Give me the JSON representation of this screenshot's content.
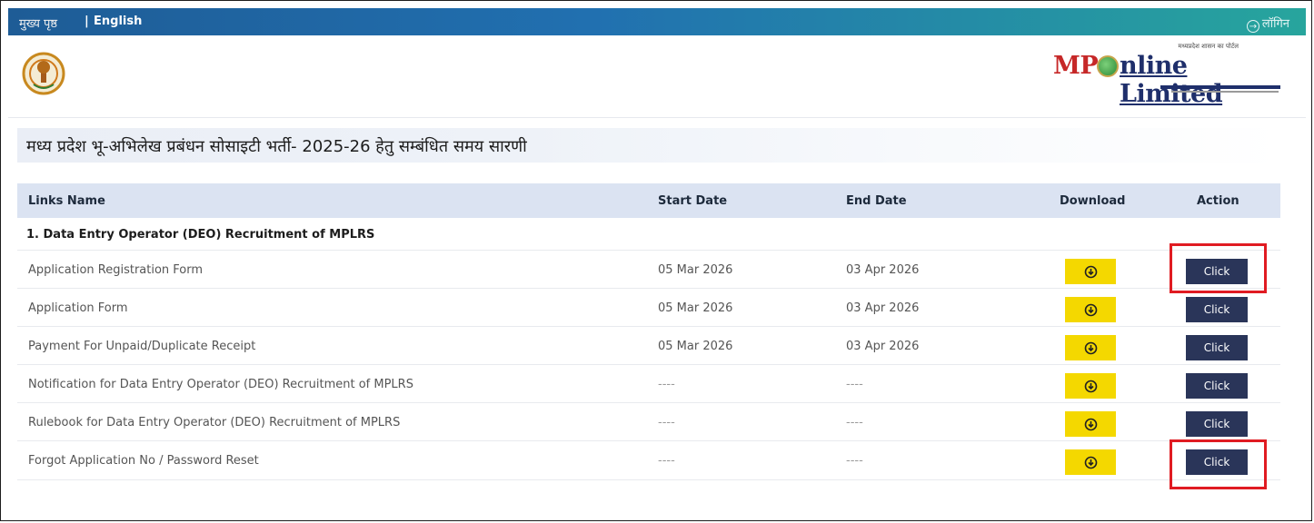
{
  "topbar": {
    "home_label": "मुख्य पृष्ठ",
    "separator": "|",
    "language_label": "English",
    "login_label": "लॉगिन"
  },
  "brand": {
    "tagline": "मध्यप्रदेश शासन का पोर्टल",
    "name_prefix": "MP",
    "name_rest": "nline Limited"
  },
  "page": {
    "title": "मध्य प्रदेश भू-अभिलेख प्रबंधन सोसाइटी भर्ती- 2025-26 हेतु सम्बंधित समय सारणी"
  },
  "table": {
    "headers": {
      "links_name": "Links Name",
      "start_date": "Start Date",
      "end_date": "End Date",
      "download": "Download",
      "action": "Action"
    },
    "section_title": "1. Data Entry Operator (DEO) Recruitment of MPLRS",
    "rows": [
      {
        "name": "Application Registration Form",
        "start": "05 Mar 2026",
        "end": "03 Apr 2026",
        "action": "Click"
      },
      {
        "name": "Application Form",
        "start": "05 Mar 2026",
        "end": "03 Apr 2026",
        "action": "Click"
      },
      {
        "name": "Payment For Unpaid/Duplicate Receipt",
        "start": "05 Mar 2026",
        "end": "03 Apr 2026",
        "action": "Click"
      },
      {
        "name": "Notification for Data Entry Operator (DEO) Recruitment of MPLRS",
        "start": "----",
        "end": "----",
        "action": "Click"
      },
      {
        "name": "Rulebook for Data Entry Operator (DEO) Recruitment of MPLRS",
        "start": "----",
        "end": "----",
        "action": "Click"
      },
      {
        "name": "Forgot Application No / Password Reset",
        "start": "----",
        "end": "----",
        "action": "Click"
      }
    ]
  },
  "colors": {
    "topbar_start": "#1e5c96",
    "topbar_end": "#27a59d",
    "header_row_bg": "#dbe3f2",
    "download_button": "#f4d800",
    "action_button": "#2a3559",
    "highlight_box": "#e01b22"
  },
  "icons": {
    "download": "download-circle-icon",
    "login": "login-arrow-icon",
    "emblem": "mp-state-emblem-icon",
    "globe": "globe-logo-icon"
  }
}
